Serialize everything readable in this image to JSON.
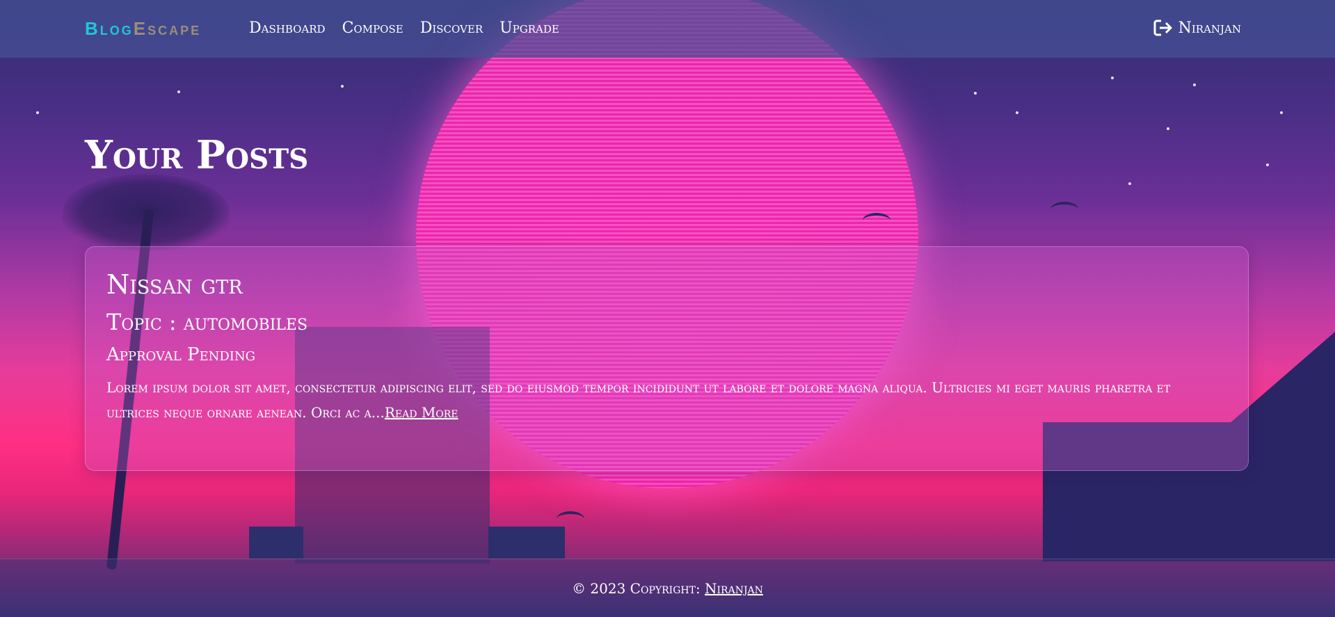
{
  "navbar": {
    "brand_part1": "Blog",
    "brand_part2": "Escape",
    "links": [
      {
        "label": "Dashboard"
      },
      {
        "label": "Compose"
      },
      {
        "label": "Discover"
      },
      {
        "label": "Upgrade"
      }
    ],
    "user_icon": "sign-out-icon",
    "user_name": "Niranjan"
  },
  "main": {
    "page_title": "Your Posts",
    "posts": [
      {
        "title": "Nissan gtr",
        "topic": "Topic : automobiles",
        "status": "Approval Pending",
        "excerpt": "Lorem ipsum dolor sit amet, consectetur adipiscing elit, sed do eiusmod tempor incididunt ut labore et dolore magna aliqua. Ultricies mi eget mauris pharetra et ultrices neque ornare aenean. Orci ac a...",
        "read_more": "Read More"
      }
    ]
  },
  "footer": {
    "copyright": "© 2023 Copyright: ",
    "author": "Niranjan"
  },
  "colors": {
    "brand_accent": "#1fc7d6",
    "brand_secondary": "#9a8f7d",
    "navbar_bg": "#4650960",
    "sun_pink": "#ff50c8"
  }
}
